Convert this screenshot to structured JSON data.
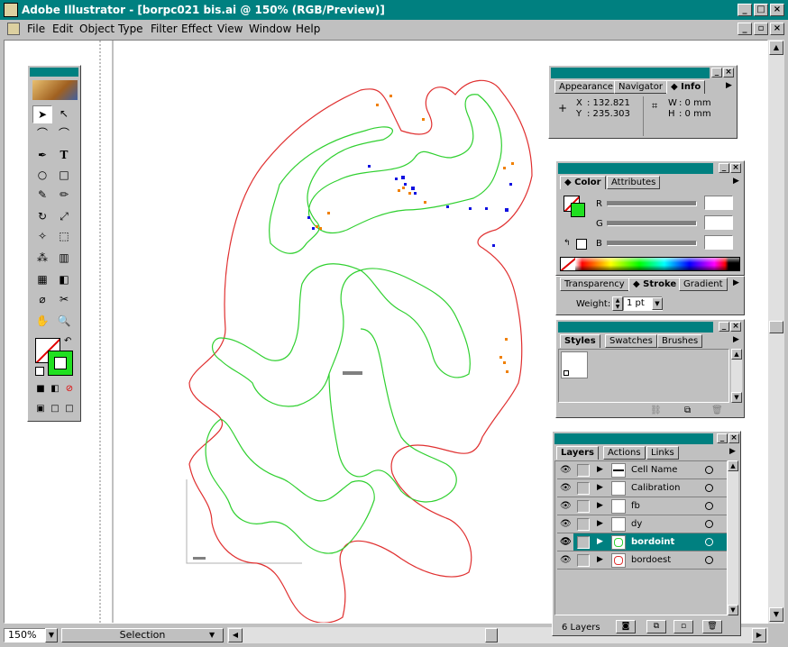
{
  "window": {
    "title": "Adobe Illustrator - [borpc021 bis.ai @ 150% (RGB/Preview)]"
  },
  "menu": [
    "File",
    "Edit",
    "Object",
    "Type",
    "Filter",
    "Effect",
    "View",
    "Window",
    "Help"
  ],
  "status": {
    "zoom": "150%",
    "tool": "Selection"
  },
  "info_palette": {
    "tabs": [
      "Appearance",
      "Navigator",
      "Info"
    ],
    "x_label": "X",
    "x_value": ": 132.821",
    "y_label": "Y",
    "y_value": ": 235.303",
    "w_label": "W",
    "w_value": ": 0 mm",
    "h_label": "H",
    "h_value": ": 0 mm"
  },
  "color_palette": {
    "tabs": [
      "Color",
      "Attributes"
    ],
    "r_label": "R",
    "g_label": "G",
    "b_label": "B"
  },
  "stroke_palette": {
    "tabs": [
      "Transparency",
      "Stroke",
      "Gradient"
    ],
    "weight_label": "Weight:",
    "weight_value": "1 pt"
  },
  "styles_palette": {
    "tabs": [
      "Styles",
      "Swatches",
      "Brushes"
    ]
  },
  "layers_palette": {
    "tabs": [
      "Layers",
      "Actions",
      "Links"
    ],
    "layers": [
      {
        "name": "Cell Name"
      },
      {
        "name": "Calibration"
      },
      {
        "name": "fb"
      },
      {
        "name": "dy"
      },
      {
        "name": "bordoint"
      },
      {
        "name": "bordoest"
      }
    ],
    "count_label": "6 Layers"
  },
  "colors": {
    "titlebar": "#008080",
    "outer_contour": "#e03030",
    "inner_contour": "#30d030",
    "orange_dots": "#f08000",
    "blue_dots": "#1010e0"
  }
}
